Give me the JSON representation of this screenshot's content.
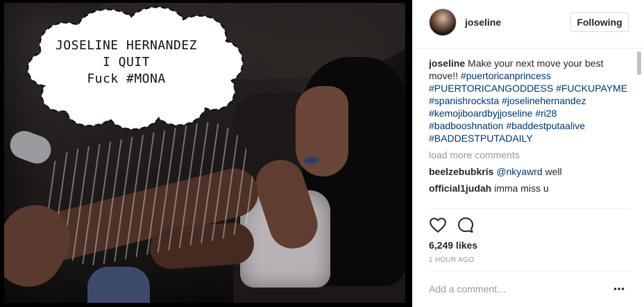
{
  "photo": {
    "overlay_text": [
      "JOSELINE HERNANDEZ",
      "I QUIT",
      "Fuck #MONA"
    ]
  },
  "header": {
    "username": "joseline",
    "follow_label": "Following"
  },
  "caption": {
    "username": "joseline",
    "text": "Make your next move your best move!!",
    "hashtags": [
      "#puertoricanprincess",
      "#PUERTORICANGODDESS",
      "#FUCKUPAYME",
      "#spanishrocksta",
      "#joselinehernandez",
      "#kemojiboardbyjjoseline",
      "#ri28",
      "#badbooshnation",
      "#baddestputaalive",
      "#BADDESTPUTADAILY"
    ]
  },
  "load_more_label": "load more comments",
  "comments": [
    {
      "username": "beelzebubkris",
      "mention": "@nkyawrd",
      "text": "well"
    },
    {
      "username": "official1judah",
      "mention": "",
      "text": "imma miss u"
    }
  ],
  "actions": {
    "likes": "6,249 likes",
    "time": "1 HOUR AGO"
  },
  "add_comment": {
    "placeholder": "Add a comment…"
  },
  "icons": {
    "like": "heart-icon",
    "comment": "comment-bubble-icon",
    "more": "more-options-icon",
    "avatar": "profile-avatar"
  },
  "colors": {
    "hashtag": "#003569",
    "muted": "#999999",
    "text": "#262626",
    "border": "#dbdbdb"
  }
}
